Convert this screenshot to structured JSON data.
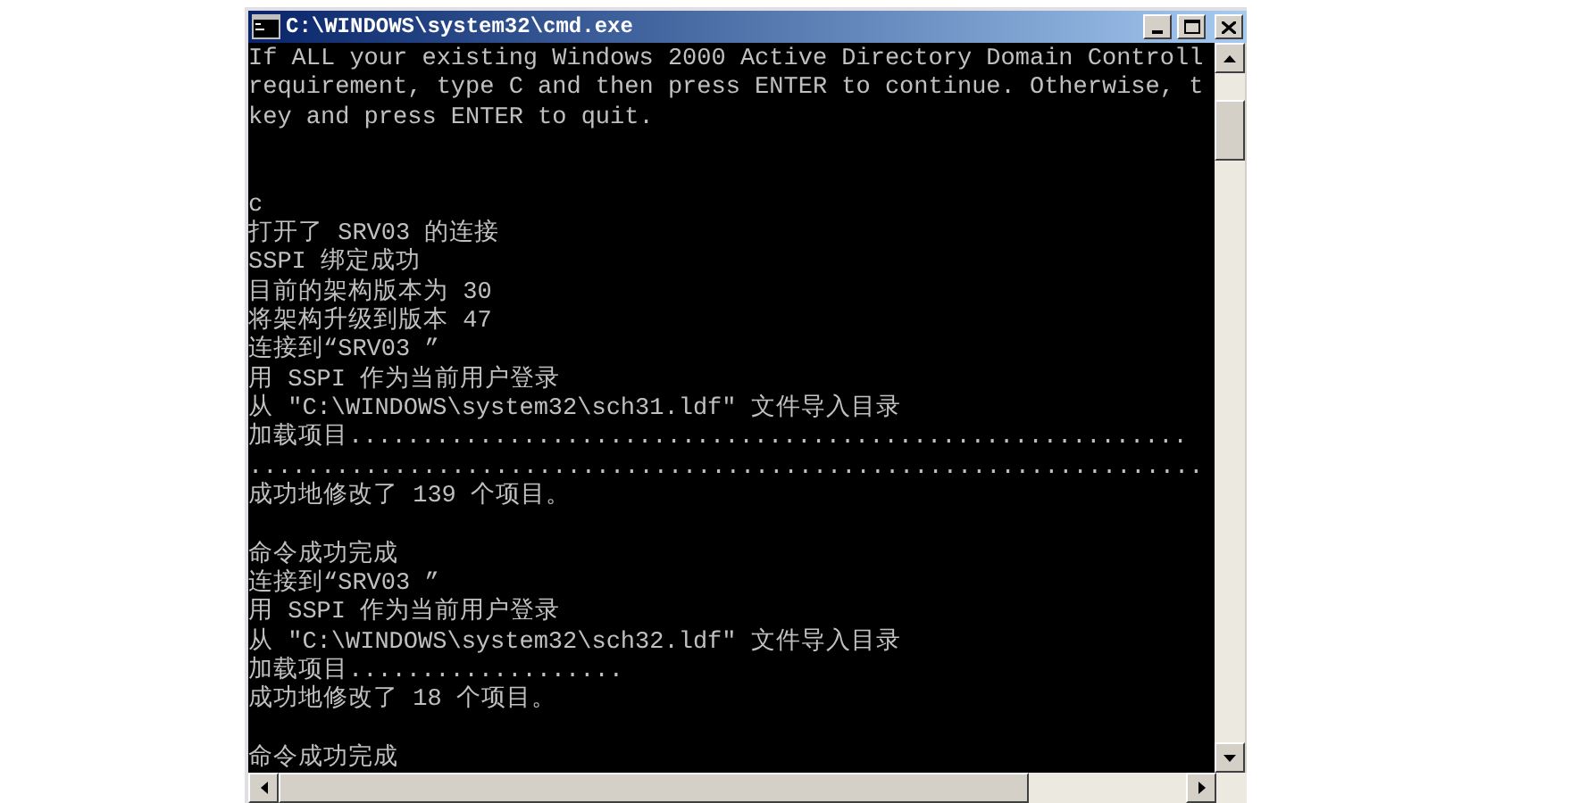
{
  "window": {
    "title": "C:\\WINDOWS\\system32\\cmd.exe"
  },
  "console": {
    "lines": [
      {
        "kind": "text",
        "text": "If ALL your existing Windows 2000 Active Directory Domain Controll"
      },
      {
        "kind": "text",
        "text": "requirement, type C and then press ENTER to continue. Otherwise, t"
      },
      {
        "kind": "text",
        "text": "key and press ENTER to quit."
      },
      {
        "kind": "blank"
      },
      {
        "kind": "blank"
      },
      {
        "kind": "text",
        "text": "c"
      },
      {
        "kind": "text",
        "text": "打开了 SRV03 的连接"
      },
      {
        "kind": "text",
        "text": "SSPI 绑定成功"
      },
      {
        "kind": "text",
        "text": "目前的架构版本为 30"
      },
      {
        "kind": "text",
        "text": "将架构升级到版本 47"
      },
      {
        "kind": "text",
        "text": "连接到“SRV03 ”"
      },
      {
        "kind": "text",
        "text": "用 SSPI 作为当前用户登录"
      },
      {
        "kind": "text",
        "text": "从 \"C:\\WINDOWS\\system32\\sch31.ldf\" 文件导入目录"
      },
      {
        "kind": "text",
        "text": "加载项目.........................................................."
      },
      {
        "kind": "text",
        "text": ".................................................................."
      },
      {
        "kind": "text",
        "text": "成功地修改了 139 个项目。"
      },
      {
        "kind": "blank"
      },
      {
        "kind": "text",
        "text": "命令成功完成"
      },
      {
        "kind": "text",
        "text": "连接到“SRV03 ”"
      },
      {
        "kind": "text",
        "text": "用 SSPI 作为当前用户登录"
      },
      {
        "kind": "text",
        "text": "从 \"C:\\WINDOWS\\system32\\sch32.ldf\" 文件导入目录"
      },
      {
        "kind": "text",
        "text": "加载项目..................."
      },
      {
        "kind": "text",
        "text": "成功地修改了 18 个项目。"
      },
      {
        "kind": "blank"
      },
      {
        "kind": "text",
        "text": "命令成功完成"
      }
    ]
  }
}
